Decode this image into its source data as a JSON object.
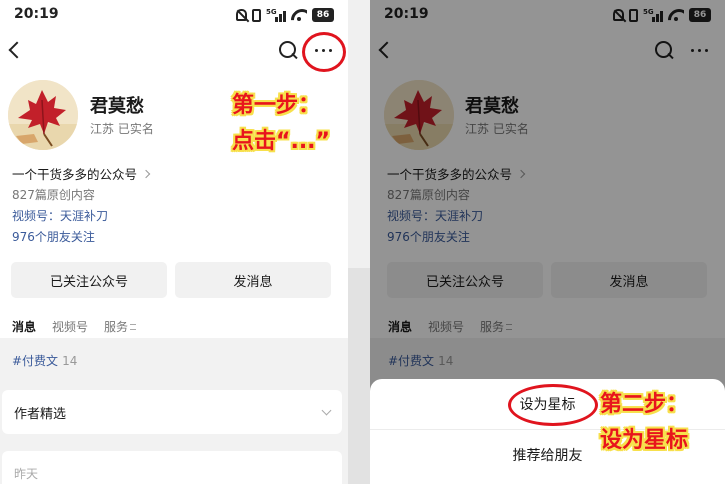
{
  "status_bar": {
    "time": "20:19",
    "signal": "5G",
    "battery": "86"
  },
  "profile": {
    "name": "君莫愁",
    "location": "江苏 已实名",
    "description": "一个干货多多的公众号",
    "articles": "827篇原创内容",
    "video_channel": "视频号：天涯补刀",
    "friends_following": "976个朋友关注"
  },
  "actions": {
    "followed_label": "已关注公众号",
    "message_label": "发消息"
  },
  "tabs": [
    {
      "label": "消息",
      "active": true
    },
    {
      "label": "视频号",
      "active": false
    },
    {
      "label": "服务",
      "active": false
    }
  ],
  "feed": {
    "topic": "#付费文",
    "topic_count": "14",
    "selected_section": "作者精选",
    "yesterday": "昨天"
  },
  "annotations": {
    "step1_line1": "第一步：",
    "step1_line2": "点击“...”",
    "step2_line1": "第二步：",
    "step2_line2": "设为星标",
    "highlight_color": "#e0141e",
    "outline_color": "#f7e04c"
  },
  "action_sheet": {
    "items": [
      "设为星标",
      "推荐给朋友"
    ]
  }
}
